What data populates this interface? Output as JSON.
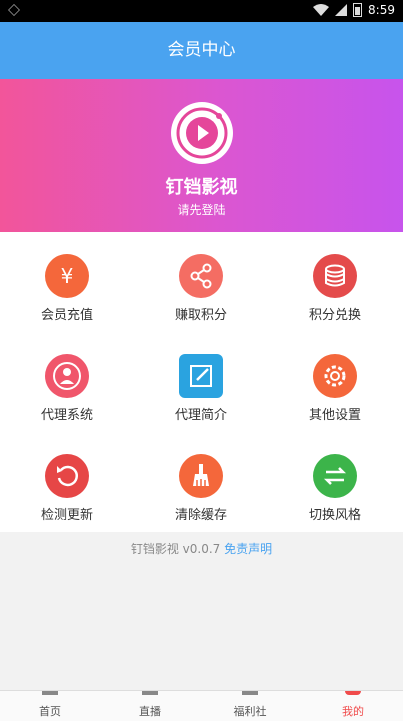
{
  "status_bar": {
    "time": "8:59"
  },
  "header": {
    "title": "会员中心"
  },
  "profile": {
    "app_name": "钉铛影视",
    "login_prompt": "请先登陆"
  },
  "menu": [
    {
      "label": "会员充值",
      "icon": "yen-icon",
      "color": "#f4673b"
    },
    {
      "label": "赚取积分",
      "icon": "share-icon",
      "color": "#f46d63"
    },
    {
      "label": "积分兑换",
      "icon": "coin-stack-icon",
      "color": "#e44b4b"
    },
    {
      "label": "代理系统",
      "icon": "user-icon",
      "color": "#f0566b"
    },
    {
      "label": "代理简介",
      "icon": "edit-icon",
      "color": "#2aa3e0"
    },
    {
      "label": "其他设置",
      "icon": "gear-icon",
      "color": "#f4673b"
    },
    {
      "label": "检测更新",
      "icon": "refresh-icon",
      "color": "#e64646"
    },
    {
      "label": "清除缓存",
      "icon": "broom-icon",
      "color": "#f4673b"
    },
    {
      "label": "切换风格",
      "icon": "swap-icon",
      "color": "#3cb44a"
    }
  ],
  "footer": {
    "version": "钉铛影视 v0.0.7",
    "disclaimer": "免责声明"
  },
  "tabs": [
    {
      "label": "首页"
    },
    {
      "label": "直播"
    },
    {
      "label": "福利社"
    },
    {
      "label": "我的"
    }
  ]
}
